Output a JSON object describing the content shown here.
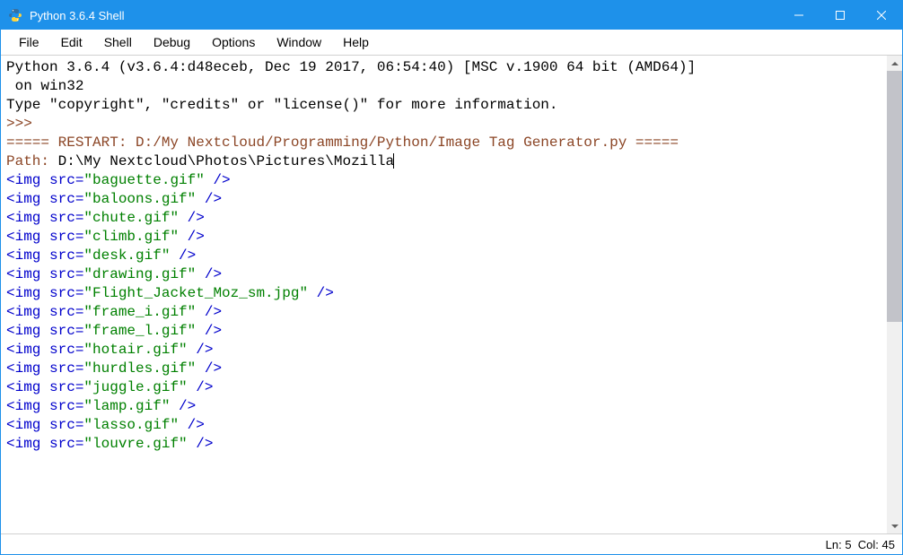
{
  "window": {
    "title": "Python 3.6.4 Shell"
  },
  "menu": {
    "file": "File",
    "edit": "Edit",
    "shell": "Shell",
    "debug": "Debug",
    "options": "Options",
    "window": "Window",
    "help": "Help"
  },
  "shell": {
    "banner1": "Python 3.6.4 (v3.6.4:d48eceb, Dec 19 2017, 06:54:40) [MSC v.1900 64 bit (AMD64)]",
    "banner2": " on win32",
    "info": "Type \"copyright\", \"credits\" or \"license()\" for more information.",
    "prompt1": ">>> ",
    "restart": "===== RESTART: D:/My Nextcloud/Programming/Python/Image Tag Generator.py =====",
    "input_prompt": "Path: ",
    "input_value": "D:\\My Nextcloud\\Photos\\Pictures\\Mozilla",
    "img_tags": [
      {
        "pre": "<img src=",
        "file": "\"baguette.gif\"",
        "post": " />"
      },
      {
        "pre": "<img src=",
        "file": "\"baloons.gif\"",
        "post": " />"
      },
      {
        "pre": "<img src=",
        "file": "\"chute.gif\"",
        "post": " />"
      },
      {
        "pre": "<img src=",
        "file": "\"climb.gif\"",
        "post": " />"
      },
      {
        "pre": "<img src=",
        "file": "\"desk.gif\"",
        "post": " />"
      },
      {
        "pre": "<img src=",
        "file": "\"drawing.gif\"",
        "post": " />"
      },
      {
        "pre": "<img src=",
        "file": "\"Flight_Jacket_Moz_sm.jpg\"",
        "post": " />"
      },
      {
        "pre": "<img src=",
        "file": "\"frame_i.gif\"",
        "post": " />"
      },
      {
        "pre": "<img src=",
        "file": "\"frame_l.gif\"",
        "post": " />"
      },
      {
        "pre": "<img src=",
        "file": "\"hotair.gif\"",
        "post": " />"
      },
      {
        "pre": "<img src=",
        "file": "\"hurdles.gif\"",
        "post": " />"
      },
      {
        "pre": "<img src=",
        "file": "\"juggle.gif\"",
        "post": " />"
      },
      {
        "pre": "<img src=",
        "file": "\"lamp.gif\"",
        "post": " />"
      },
      {
        "pre": "<img src=",
        "file": "\"lasso.gif\"",
        "post": " />"
      },
      {
        "pre": "<img src=",
        "file": "\"louvre.gif\"",
        "post": " />"
      }
    ]
  },
  "status": {
    "ln_label": "Ln:",
    "ln": "5",
    "col_label": "Col:",
    "col": "45"
  }
}
